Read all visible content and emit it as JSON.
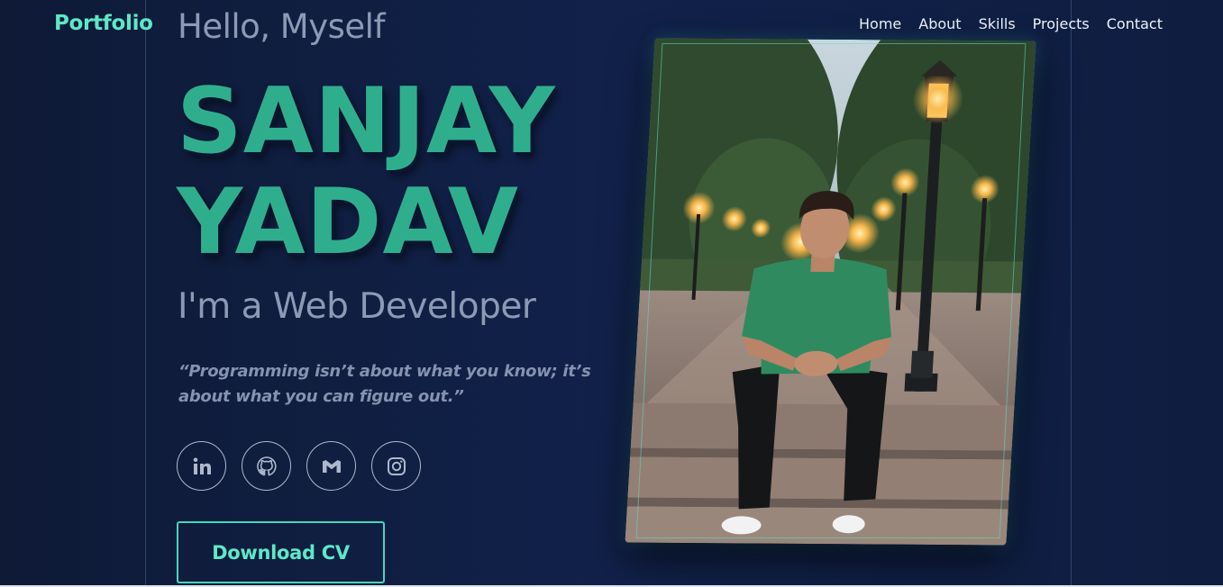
{
  "brand": {
    "logo": "Portfolio"
  },
  "nav": {
    "items": [
      "Home",
      "About",
      "Skills",
      "Projects",
      "Contact"
    ]
  },
  "hero": {
    "greeting": "Hello, Myself",
    "name_line1": "SANJAY",
    "name_line2": "YADAV",
    "role": "I'm a Web Developer",
    "quote_line1": "“Programming isn’t about what you know; it’s",
    "quote_line2": "about what you can figure out.”",
    "cta_label": "Download CV"
  },
  "socials": [
    {
      "icon": "linkedin-icon"
    },
    {
      "icon": "github-icon"
    },
    {
      "icon": "gmail-icon"
    },
    {
      "icon": "instagram-icon"
    }
  ],
  "colors": {
    "background": "#0f1b3a",
    "accent": "#5de8c8",
    "name": "#2fae8d",
    "muted_text": "#8d9ab5",
    "nav_text": "#f0f3fa"
  }
}
